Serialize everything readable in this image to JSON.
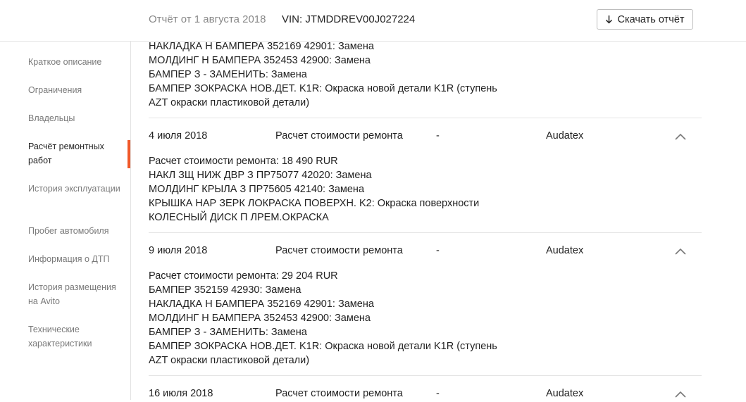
{
  "header": {
    "report_date": "Отчёт от 1 августа 2018",
    "vin": "VIN: JTMDDREV00J027224",
    "download_label": "Скачать отчёт"
  },
  "sidebar": {
    "items": [
      {
        "label": "Краткое описание"
      },
      {
        "label": "Ограничения"
      },
      {
        "label": "Владельцы"
      },
      {
        "label": "Расчёт ремонтных работ",
        "active": true
      },
      {
        "label": "История эксплуатации"
      },
      {
        "label": "Пробег автомобиля"
      },
      {
        "label": "Информация о ДТП"
      },
      {
        "label": "История размещения на Avito"
      },
      {
        "label": "Технические характеристики"
      }
    ]
  },
  "repairs": {
    "partial_top": [
      "НАКЛАДКА Н БАМПЕРА 352169 42901: Замена",
      "МОЛДИНГ Н БАМПЕРА 352453 42900: Замена",
      "БАМПЕР З - ЗАМЕНИТЬ: Замена",
      "БАМПЕР ЗОКРАСКА НОВ.ДЕТ. K1R: Окраска новой детали K1R (ступень",
      "AZT окраски пластиковой детали)"
    ],
    "entries": [
      {
        "date": "4 июля 2018",
        "type": "Расчет стоимости ремонта",
        "dash": "-",
        "source": "Audatex",
        "lines": [
          "Расчет стоимости ремонта: 18 490 RUR",
          "НАКЛ ЗЩ НИЖ ДВР З ПР75077 42020: Замена",
          "МОЛДИНГ КРЫЛА З ПР75605 42140: Замена",
          "КРЫШКА НАР ЗЕРК ЛОКРАСКА ПОВЕРХН. K2: Окраска поверхности",
          "КОЛЕСНЫЙ ДИСК П ЛРЕМ.ОКРАСКА"
        ]
      },
      {
        "date": "9 июля 2018",
        "type": "Расчет стоимости ремонта",
        "dash": "-",
        "source": "Audatex",
        "lines": [
          "Расчет стоимости ремонта: 29 204 RUR",
          "БАМПЕР 352159 42930: Замена",
          "НАКЛАДКА Н БАМПЕРА 352169 42901: Замена",
          "МОЛДИНГ Н БАМПЕРА 352453 42900: Замена",
          "БАМПЕР З - ЗАМЕНИТЬ: Замена",
          "БАМПЕР ЗОКРАСКА НОВ.ДЕТ. K1R: Окраска новой детали K1R (ступень",
          "AZT окраски пластиковой детали)"
        ]
      },
      {
        "date": "16 июля 2018",
        "type": "Расчет стоимости ремонта",
        "dash": "-",
        "source": "Audatex",
        "lines": []
      }
    ]
  },
  "colors": {
    "accent": "#f0592a",
    "muted_text": "#888888",
    "sidebar_text": "#7a7a7a",
    "divider": "#e4e4e4"
  },
  "icons": {
    "download": "arrow-down-icon",
    "collapse": "chevron-up-icon"
  }
}
